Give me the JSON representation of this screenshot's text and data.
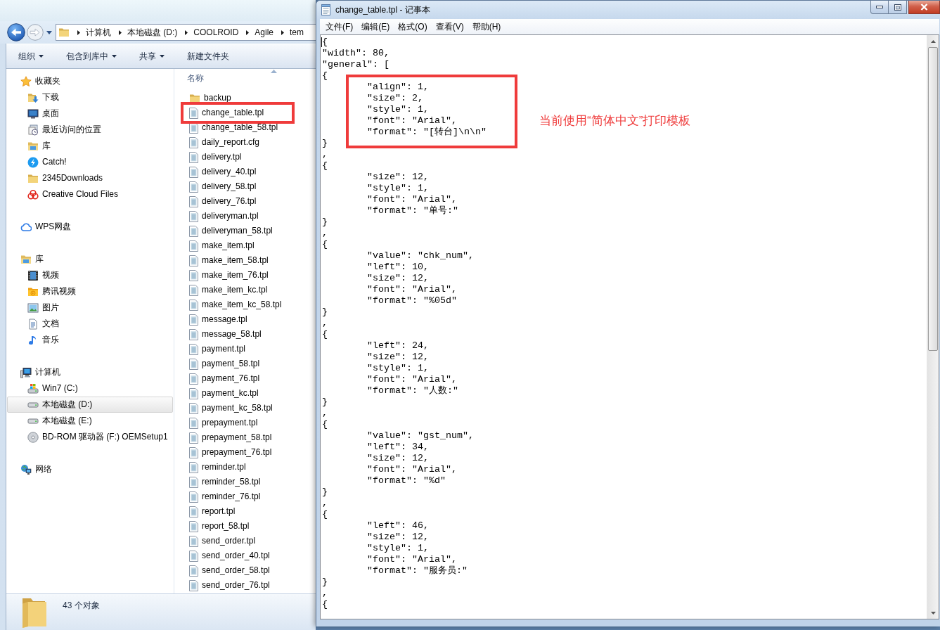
{
  "explorer": {
    "address_bar": {
      "segments": [
        "计算机",
        "本地磁盘 (D:)",
        "COOLROID",
        "Agile",
        "tem"
      ]
    },
    "toolbar": [
      {
        "label": "组织",
        "dropdown": true
      },
      {
        "label": "包含到库中",
        "dropdown": true
      },
      {
        "label": "共享",
        "dropdown": true
      },
      {
        "label": "新建文件夹",
        "dropdown": false
      }
    ],
    "nav_pane": {
      "groups": [
        {
          "label": "收藏夹",
          "selected": false,
          "children": [
            {
              "label": "下载",
              "selected": false
            },
            {
              "label": "桌面",
              "selected": false
            },
            {
              "label": "最近访问的位置",
              "selected": false
            },
            {
              "label": "库",
              "selected": false
            },
            {
              "label": "Catch!",
              "selected": false
            },
            {
              "label": "2345Downloads",
              "selected": false
            },
            {
              "label": "Creative Cloud Files",
              "selected": false
            }
          ]
        },
        {
          "label": "WPS网盘",
          "selected": false
        },
        {
          "label": "库",
          "selected": false,
          "children": [
            {
              "label": "视频",
              "selected": false
            },
            {
              "label": "腾讯视频",
              "selected": false
            },
            {
              "label": "图片",
              "selected": false
            },
            {
              "label": "文档",
              "selected": false
            },
            {
              "label": "音乐",
              "selected": false
            }
          ]
        },
        {
          "label": "计算机",
          "selected": false,
          "children": [
            {
              "label": "Win7 (C:)",
              "selected": false
            },
            {
              "label": "本地磁盘 (D:)",
              "selected": true
            },
            {
              "label": "本地磁盘 (E:)",
              "selected": false
            },
            {
              "label": "BD-ROM 驱动器 (F:) OEMSetup1",
              "selected": false
            }
          ]
        },
        {
          "label": "网络",
          "selected": false
        }
      ]
    },
    "file_list": {
      "column": "名称",
      "files": [
        {
          "name": "backup",
          "kind": "folder",
          "framed": false
        },
        {
          "name": "change_table.tpl",
          "kind": "file",
          "framed": true
        },
        {
          "name": "change_table_58.tpl",
          "kind": "file",
          "framed": false
        },
        {
          "name": "daily_report.cfg",
          "kind": "file",
          "framed": false
        },
        {
          "name": "delivery.tpl",
          "kind": "file",
          "framed": false
        },
        {
          "name": "delivery_40.tpl",
          "kind": "file",
          "framed": false
        },
        {
          "name": "delivery_58.tpl",
          "kind": "file",
          "framed": false
        },
        {
          "name": "delivery_76.tpl",
          "kind": "file",
          "framed": false
        },
        {
          "name": "deliveryman.tpl",
          "kind": "file",
          "framed": false
        },
        {
          "name": "deliveryman_58.tpl",
          "kind": "file",
          "framed": false
        },
        {
          "name": "make_item.tpl",
          "kind": "file",
          "framed": false
        },
        {
          "name": "make_item_58.tpl",
          "kind": "file",
          "framed": false
        },
        {
          "name": "make_item_76.tpl",
          "kind": "file",
          "framed": false
        },
        {
          "name": "make_item_kc.tpl",
          "kind": "file",
          "framed": false
        },
        {
          "name": "make_item_kc_58.tpl",
          "kind": "file",
          "framed": false
        },
        {
          "name": "message.tpl",
          "kind": "file",
          "framed": false
        },
        {
          "name": "message_58.tpl",
          "kind": "file",
          "framed": false
        },
        {
          "name": "payment.tpl",
          "kind": "file",
          "framed": false
        },
        {
          "name": "payment_58.tpl",
          "kind": "file",
          "framed": false
        },
        {
          "name": "payment_76.tpl",
          "kind": "file",
          "framed": false
        },
        {
          "name": "payment_kc.tpl",
          "kind": "file",
          "framed": false
        },
        {
          "name": "payment_kc_58.tpl",
          "kind": "file",
          "framed": false
        },
        {
          "name": "prepayment.tpl",
          "kind": "file",
          "framed": false
        },
        {
          "name": "prepayment_58.tpl",
          "kind": "file",
          "framed": false
        },
        {
          "name": "prepayment_76.tpl",
          "kind": "file",
          "framed": false
        },
        {
          "name": "reminder.tpl",
          "kind": "file",
          "framed": false
        },
        {
          "name": "reminder_58.tpl",
          "kind": "file",
          "framed": false
        },
        {
          "name": "reminder_76.tpl",
          "kind": "file",
          "framed": false
        },
        {
          "name": "report.tpl",
          "kind": "file",
          "framed": false
        },
        {
          "name": "report_58.tpl",
          "kind": "file",
          "framed": false
        },
        {
          "name": "send_order.tpl",
          "kind": "file",
          "framed": false
        },
        {
          "name": "send_order_40.tpl",
          "kind": "file",
          "framed": false
        },
        {
          "name": "send_order_58.tpl",
          "kind": "file",
          "framed": false
        },
        {
          "name": "send_order_76.tpl",
          "kind": "file",
          "framed": false
        }
      ]
    },
    "status_bar": {
      "text": "43 个对象"
    }
  },
  "notepad": {
    "title": "change_table.tpl - 记事本",
    "menu": [
      "文件(F)",
      "编辑(E)",
      "格式(O)",
      "查看(V)",
      "帮助(H)"
    ],
    "lines": [
      {
        "text": "{",
        "framed": false
      },
      {
        "text": "\"width\": 80,",
        "framed": false
      },
      {
        "text": "\"general\": [",
        "framed": false
      },
      {
        "text": "{",
        "framed": false
      },
      {
        "text": "\t\"align\": 1,",
        "framed": true
      },
      {
        "text": "\t\"size\": 2,",
        "framed": true
      },
      {
        "text": "\t\"style\": 1,",
        "framed": true
      },
      {
        "text": "\t\"font\": \"Arial\",",
        "framed": true
      },
      {
        "text": "\t\"format\": \"[转台]\\n\\n\"",
        "framed": true
      },
      {
        "text": "}",
        "framed": false
      },
      {
        "text": ",",
        "framed": false
      },
      {
        "text": "{",
        "framed": false
      },
      {
        "text": "\t\"size\": 12,",
        "framed": false
      },
      {
        "text": "\t\"style\": 1,",
        "framed": false
      },
      {
        "text": "\t\"font\": \"Arial\",",
        "framed": false
      },
      {
        "text": "\t\"format\": \"单号:\"",
        "framed": false
      },
      {
        "text": "}",
        "framed": false
      },
      {
        "text": ",",
        "framed": false
      },
      {
        "text": "{",
        "framed": false
      },
      {
        "text": "\t\"value\": \"chk_num\",",
        "framed": false
      },
      {
        "text": "\t\"left\": 10,",
        "framed": false
      },
      {
        "text": "\t\"size\": 12,",
        "framed": false
      },
      {
        "text": "\t\"font\": \"Arial\",",
        "framed": false
      },
      {
        "text": "\t\"format\": \"%05d\"",
        "framed": false
      },
      {
        "text": "}",
        "framed": false
      },
      {
        "text": ",",
        "framed": false
      },
      {
        "text": "{",
        "framed": false
      },
      {
        "text": "\t\"left\": 24,",
        "framed": false
      },
      {
        "text": "\t\"size\": 12,",
        "framed": false
      },
      {
        "text": "\t\"style\": 1,",
        "framed": false
      },
      {
        "text": "\t\"font\": \"Arial\",",
        "framed": false
      },
      {
        "text": "\t\"format\": \"人数:\"",
        "framed": false
      },
      {
        "text": "}",
        "framed": false
      },
      {
        "text": ",",
        "framed": false
      },
      {
        "text": "{",
        "framed": false
      },
      {
        "text": "\t\"value\": \"gst_num\",",
        "framed": false
      },
      {
        "text": "\t\"left\": 34,",
        "framed": false
      },
      {
        "text": "\t\"size\": 12,",
        "framed": false
      },
      {
        "text": "\t\"font\": \"Arial\",",
        "framed": false
      },
      {
        "text": "\t\"format\": \"%d\"",
        "framed": false
      },
      {
        "text": "}",
        "framed": false
      },
      {
        "text": ",",
        "framed": false
      },
      {
        "text": "{",
        "framed": false
      },
      {
        "text": "\t\"left\": 46,",
        "framed": false
      },
      {
        "text": "\t\"size\": 12,",
        "framed": false
      },
      {
        "text": "\t\"style\": 1,",
        "framed": false
      },
      {
        "text": "\t\"font\": \"Arial\",",
        "framed": false
      },
      {
        "text": "\t\"format\": \"服务员:\"",
        "framed": false
      },
      {
        "text": "}",
        "framed": false
      },
      {
        "text": ",",
        "framed": false
      },
      {
        "text": "{",
        "framed": false
      }
    ],
    "callout": "当前使用“简体中文”打印模板"
  }
}
